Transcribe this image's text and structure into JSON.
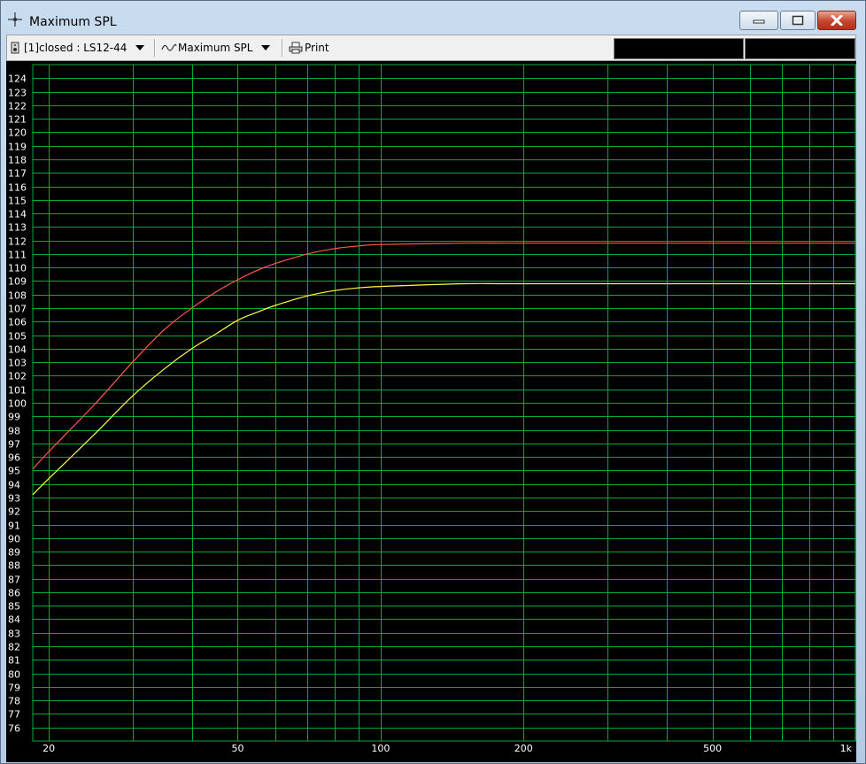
{
  "window": {
    "title": "Maximum SPL",
    "app_icon": "crosshair-icon",
    "buttons": {
      "minimize": "minimize-icon",
      "maximize": "maximize-icon",
      "close": "close-icon"
    }
  },
  "toolbar": {
    "project_label": "[1]closed : LS12-44",
    "project_icon": "speaker-box-icon",
    "graph_label": "Maximum SPL",
    "graph_icon": "sine-wave-icon",
    "print_label": "Print",
    "print_icon": "printer-icon"
  },
  "colors": {
    "plot_background": "#000000",
    "grid": "#00aa3a",
    "axis_text": "#ffffff",
    "series_1": "#ff5a4a",
    "series_2": "#ffff40"
  },
  "chart_data": {
    "type": "line",
    "title": "",
    "xlabel": "",
    "ylabel": "",
    "xscale": "log",
    "xlim": [
      18.5,
      1000
    ],
    "ylim": [
      75,
      125
    ],
    "x_tick_labels": [
      {
        "value": 20,
        "label": "20"
      },
      {
        "value": 50,
        "label": "50"
      },
      {
        "value": 100,
        "label": "100"
      },
      {
        "value": 200,
        "label": "200"
      },
      {
        "value": 500,
        "label": "500"
      },
      {
        "value": 1000,
        "label": "1k"
      }
    ],
    "x_grid": [
      20,
      30,
      40,
      50,
      60,
      70,
      80,
      90,
      100,
      200,
      300,
      400,
      500,
      600,
      700,
      800,
      900,
      1000
    ],
    "y_ticks": [
      76,
      77,
      78,
      79,
      80,
      81,
      82,
      83,
      84,
      85,
      86,
      87,
      88,
      89,
      90,
      91,
      92,
      93,
      94,
      95,
      96,
      97,
      98,
      99,
      100,
      101,
      102,
      103,
      104,
      105,
      106,
      107,
      108,
      109,
      110,
      111,
      112,
      113,
      114,
      115,
      116,
      117,
      118,
      119,
      120,
      121,
      122,
      123,
      124
    ],
    "grid": true,
    "legend": "none",
    "series": [
      {
        "color": "#ff5a4a",
        "points": [
          [
            18.5,
            95.1
          ],
          [
            20,
            96.4
          ],
          [
            25,
            99.9
          ],
          [
            30,
            103.0
          ],
          [
            35,
            105.4
          ],
          [
            40,
            107.0
          ],
          [
            45,
            108.2
          ],
          [
            50,
            109.1
          ],
          [
            55,
            109.8
          ],
          [
            60,
            110.3
          ],
          [
            70,
            111.0
          ],
          [
            80,
            111.4
          ],
          [
            90,
            111.6
          ],
          [
            100,
            111.7
          ],
          [
            150,
            111.8
          ],
          [
            200,
            111.8
          ],
          [
            500,
            111.8
          ],
          [
            1000,
            111.8
          ]
        ]
      },
      {
        "color": "#ffff40",
        "points": [
          [
            18.5,
            93.2
          ],
          [
            20,
            94.4
          ],
          [
            25,
            97.7
          ],
          [
            30,
            100.5
          ],
          [
            35,
            102.5
          ],
          [
            40,
            104.0
          ],
          [
            45,
            105.1
          ],
          [
            50,
            106.1
          ],
          [
            55,
            106.7
          ],
          [
            60,
            107.2
          ],
          [
            70,
            107.9
          ],
          [
            80,
            108.3
          ],
          [
            90,
            108.5
          ],
          [
            100,
            108.6
          ],
          [
            150,
            108.8
          ],
          [
            200,
            108.8
          ],
          [
            500,
            108.8
          ],
          [
            1000,
            108.8
          ]
        ]
      }
    ]
  }
}
